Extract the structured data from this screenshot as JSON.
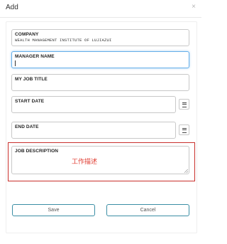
{
  "dialog": {
    "title": "Add",
    "close_glyph": "×"
  },
  "form": {
    "company": {
      "label": "COMPANY",
      "value": "WEALTH MANAGEMENT INSTITUTE OF LUJIAZUI"
    },
    "manager_name": {
      "label": "MANAGER NAME",
      "value": ""
    },
    "my_job_title": {
      "label": "MY JOB TITLE",
      "value": ""
    },
    "start_date": {
      "label": "START DATE",
      "value": ""
    },
    "end_date": {
      "label": "END DATE",
      "value": ""
    },
    "job_description": {
      "label": "JOB DESCRIPTION",
      "value": ""
    }
  },
  "annotation": {
    "text": "工作描述",
    "color": "#e03c31"
  },
  "buttons": {
    "save_label": "Save",
    "cancel_label": "Cancel"
  },
  "colors": {
    "focus_border": "#66afe9",
    "button_border": "#3b8ea5",
    "highlight_border": "#c9302c"
  },
  "icons": {
    "close": "close-icon",
    "calendar": "calendar-icon"
  }
}
